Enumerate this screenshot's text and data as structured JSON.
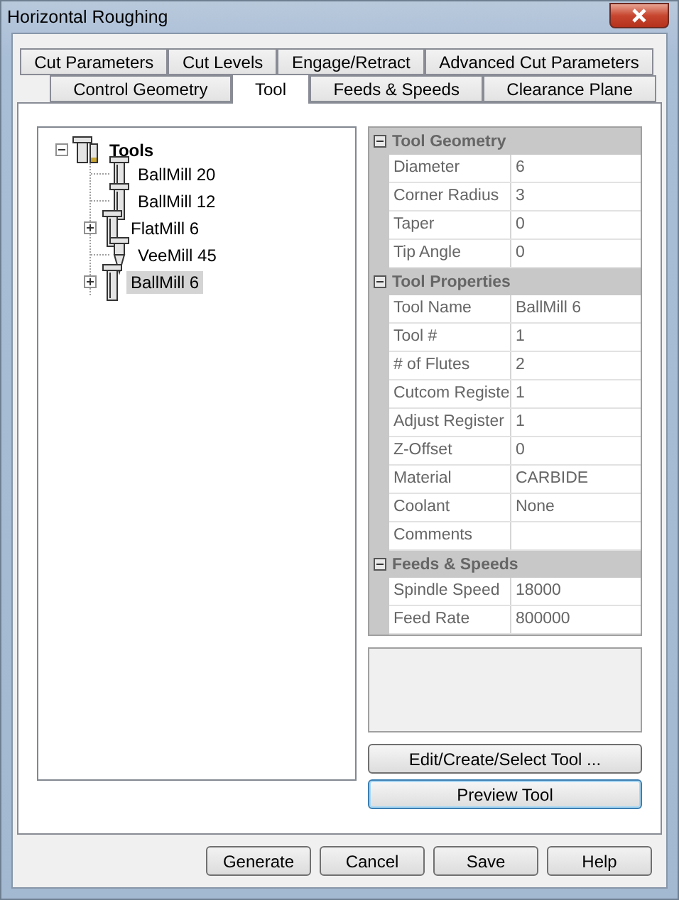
{
  "window": {
    "title": "Horizontal Roughing"
  },
  "tab_rows": [
    [
      {
        "label": "Cut Parameters",
        "selected": false
      },
      {
        "label": "Cut Levels",
        "selected": false
      },
      {
        "label": "Engage/Retract",
        "selected": false
      },
      {
        "label": "Advanced Cut Parameters",
        "selected": false
      }
    ],
    [
      {
        "label": "Control Geometry",
        "selected": false
      },
      {
        "label": "Tool",
        "selected": true
      },
      {
        "label": "Feeds & Speeds",
        "selected": false
      },
      {
        "label": "Clearance Plane",
        "selected": false
      }
    ]
  ],
  "tree": {
    "label": "Tools",
    "expanded": true,
    "children": [
      {
        "label": "BallMill 20",
        "kind": "mill",
        "has_children": false,
        "selected": false
      },
      {
        "label": "BallMill 12",
        "kind": "mill",
        "has_children": false,
        "selected": false
      },
      {
        "label": "FlatMill 6",
        "kind": "mill",
        "has_children": true,
        "selected": false
      },
      {
        "label": "VeeMill 45",
        "kind": "vee",
        "has_children": false,
        "selected": false
      },
      {
        "label": "BallMill 6",
        "kind": "mill",
        "has_children": true,
        "selected": true
      }
    ]
  },
  "property_grid": [
    {
      "category": "Tool Geometry",
      "expanded": true,
      "rows": [
        {
          "name": "Diameter",
          "value": "6"
        },
        {
          "name": "Corner Radius",
          "value": "3"
        },
        {
          "name": "Taper",
          "value": "0"
        },
        {
          "name": "Tip Angle",
          "value": "0"
        }
      ]
    },
    {
      "category": "Tool Properties",
      "expanded": true,
      "rows": [
        {
          "name": "Tool Name",
          "value": "BallMill 6"
        },
        {
          "name": "Tool #",
          "value": "1"
        },
        {
          "name": "# of Flutes",
          "value": "2"
        },
        {
          "name": "Cutcom Registe",
          "value": "1"
        },
        {
          "name": "Adjust Register",
          "value": "1"
        },
        {
          "name": "Z-Offset",
          "value": "0"
        },
        {
          "name": "Material",
          "value": "CARBIDE"
        },
        {
          "name": "Coolant",
          "value": "None"
        },
        {
          "name": "Comments"
        }
      ]
    },
    {
      "category": "Feeds & Speeds",
      "expanded": true,
      "rows": [
        {
          "name": "Spindle Speed",
          "value": "18000"
        },
        {
          "name": "Feed Rate",
          "value": "800000"
        }
      ]
    }
  ],
  "side_buttons": [
    {
      "label": "Edit/Create/Select Tool ...",
      "focused": false
    },
    {
      "label": "Preview Tool",
      "focused": true
    }
  ],
  "buttons": [
    "Generate",
    "Cancel",
    "Save",
    "Help"
  ]
}
